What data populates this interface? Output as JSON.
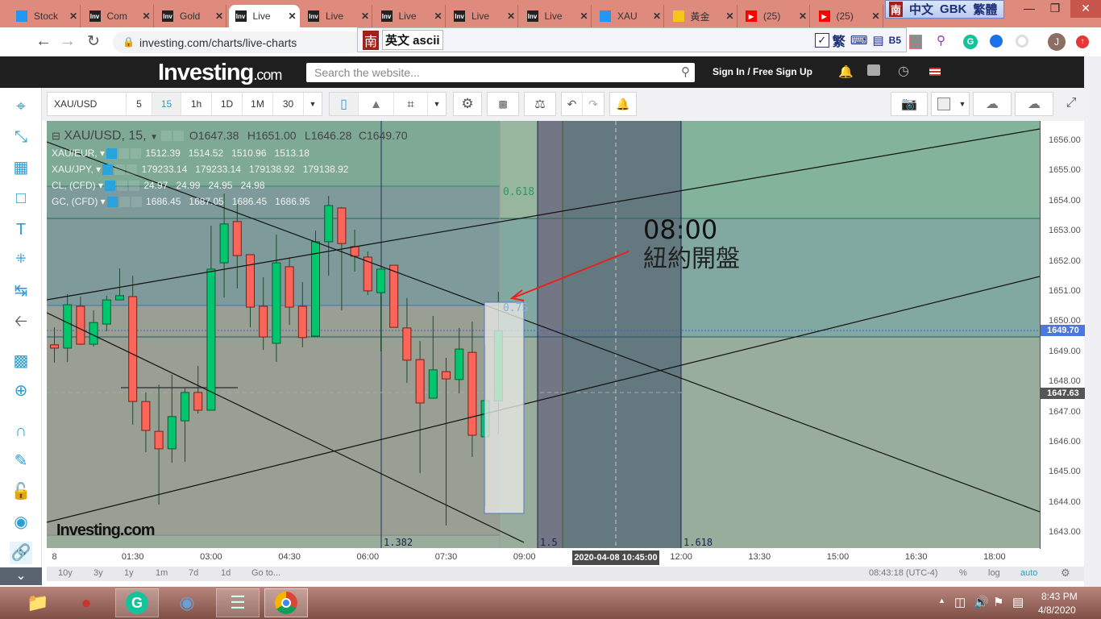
{
  "browser": {
    "tabs": [
      {
        "title": "Stock",
        "icon": "cloud"
      },
      {
        "title": "Com",
        "icon": "inv"
      },
      {
        "title": "Gold",
        "icon": "inv"
      },
      {
        "title": "Live",
        "icon": "inv"
      },
      {
        "title": "Live",
        "icon": "inv"
      },
      {
        "title": "Live",
        "icon": "inv"
      },
      {
        "title": "Live",
        "icon": "inv"
      },
      {
        "title": "Live",
        "icon": "inv"
      },
      {
        "title": "XAU",
        "icon": "cloud"
      },
      {
        "title": "黃金",
        "icon": "gem"
      },
      {
        "title": "(25)",
        "icon": "youtube"
      },
      {
        "title": "(25)",
        "icon": "youtube"
      }
    ],
    "active_tab": 3,
    "url": "investing.com/charts/live-charts",
    "ime_top": {
      "icon": "南",
      "mode": "中文",
      "enc": "GBK",
      "script": "繁體"
    },
    "ime_bar": {
      "icon": "南",
      "mode": "英文 ascii",
      "icons": [
        "繁",
        "B5"
      ]
    },
    "avatar": "J"
  },
  "site": {
    "logo": "Investing",
    "logo_suffix": ".com",
    "search_placeholder": "Search the website...",
    "signin": "Sign In / Free Sign Up"
  },
  "toolbar": {
    "symbol": "XAU/USD",
    "intervals": [
      "5",
      "15",
      "1h",
      "1D",
      "1M",
      "30"
    ],
    "active_interval": "15"
  },
  "legend": {
    "main": {
      "symbol": "XAU/USD, 15,",
      "o": "O1647.38",
      "h": "H1651.00",
      "l": "L1646.28",
      "c": "C1649.70"
    },
    "overlays": [
      {
        "name": "XAU/EUR,",
        "values": "1512.39   1514.52   1510.96   1513.18"
      },
      {
        "name": "XAU/JPY,",
        "values": "179233.14   179233.14   179138.92   179138.92"
      },
      {
        "name": "CL, (CFD)",
        "values": "24.97   24.99   24.95   24.98"
      },
      {
        "name": "GC, (CFD)",
        "values": "1686.45   1687.05   1686.45   1686.95"
      }
    ]
  },
  "annotations": {
    "time": "08:00",
    "text": "紐約開盤",
    "fib_labels": [
      "0.618",
      "0.75",
      "1.382",
      "1.5",
      "1.618"
    ],
    "watermark": "Investing.com"
  },
  "chart_data": {
    "type": "candlestick",
    "symbol": "XAU/USD",
    "interval": "15",
    "ylim": [
      1642.6,
      1656.7
    ],
    "yticks": [
      1643,
      1644,
      1645,
      1646,
      1647,
      1648,
      1649,
      1650,
      1651,
      1652,
      1653,
      1654,
      1655,
      1656
    ],
    "xtick_labels": [
      {
        "t": 0,
        "label": "8"
      },
      {
        "t": 6,
        "label": "01:30"
      },
      {
        "t": 12,
        "label": "03:00"
      },
      {
        "t": 18,
        "label": "04:30"
      },
      {
        "t": 24,
        "label": "06:00"
      },
      {
        "t": 30,
        "label": "07:30"
      },
      {
        "t": 36,
        "label": "09:00"
      },
      {
        "t": 48,
        "label": "12:00"
      },
      {
        "t": 54,
        "label": "13:30"
      },
      {
        "t": 60,
        "label": "15:00"
      },
      {
        "t": 66,
        "label": "16:30"
      },
      {
        "t": 72,
        "label": "18:00"
      }
    ],
    "crosshair_time": "2020-04-08 10:45:00",
    "last_price": "1649.70",
    "crosshair_price": "1647.63",
    "candles": [
      [
        1649.24,
        1649.82,
        1648.65,
        1649.13
      ],
      [
        1649.13,
        1650.92,
        1648.67,
        1650.57
      ],
      [
        1650.52,
        1650.84,
        1649.24,
        1649.26
      ],
      [
        1649.26,
        1650.38,
        1649.18,
        1649.98
      ],
      [
        1649.93,
        1650.87,
        1649.69,
        1650.73
      ],
      [
        1650.73,
        1651.78,
        1650.73,
        1650.87
      ],
      [
        1650.84,
        1651.53,
        1646.59,
        1647.36
      ],
      [
        1647.36,
        1647.66,
        1645.68,
        1646.4
      ],
      [
        1646.37,
        1647.92,
        1643.94,
        1645.79
      ],
      [
        1645.79,
        1648.25,
        1645.33,
        1646.86
      ],
      [
        1646.72,
        1647.79,
        1645.36,
        1647.66
      ],
      [
        1647.66,
        1648.54,
        1646.96,
        1647.07
      ],
      [
        1647.07,
        1653.19,
        1647.07,
        1651.75
      ],
      [
        1651.96,
        1654.26,
        1650.81,
        1653.25
      ],
      [
        1653.33,
        1653.91,
        1651.11,
        1652.2
      ],
      [
        1652.23,
        1652.23,
        1649.82,
        1650.49
      ],
      [
        1650.52,
        1651.48,
        1649.07,
        1649.5
      ],
      [
        1649.29,
        1652.9,
        1648.67,
        1651.96
      ],
      [
        1651.83,
        1652.12,
        1649.9,
        1650.49
      ],
      [
        1650.52,
        1651.32,
        1649.16,
        1649.48
      ],
      [
        1649.53,
        1653.03,
        1649.53,
        1652.66
      ],
      [
        1652.66,
        1654.18,
        1651.53,
        1653.86
      ],
      [
        1653.78,
        1653.81,
        1650.38,
        1652.6
      ],
      [
        1652.5,
        1653.06,
        1651.67,
        1652.18
      ],
      [
        1652.15,
        1652.34,
        1650.89,
        1651.03
      ],
      [
        1650.97,
        1651.75,
        1649.02,
        1651.75
      ],
      [
        1651.88,
        1651.88,
        1649.82,
        1649.82
      ],
      [
        1649.8,
        1650.79,
        1647.98,
        1648.73
      ],
      [
        1648.75,
        1649.37,
        1644.98,
        1647.31
      ],
      [
        1647.47,
        1650.2,
        1647.47,
        1648.41
      ],
      [
        1648.35,
        1648.81,
        1643.25,
        1648.11
      ],
      [
        1648.09,
        1649.8,
        1647.63,
        1649.1
      ],
      [
        1648.99,
        1650.01,
        1645.52,
        1646.24
      ],
      [
        1646.19,
        1649.24,
        1643.89,
        1647.39
      ],
      [
        1647.38,
        1651.0,
        1646.28,
        1649.7
      ]
    ],
    "colors": {
      "up": "#00c66e",
      "down": "#fc6559"
    }
  },
  "bottom": {
    "ranges": [
      "10y",
      "3y",
      "1y",
      "1m",
      "7d",
      "1d",
      "Go to..."
    ],
    "clock": "08:43:18 (UTC-4)",
    "pct": "%",
    "log": "log",
    "auto": "auto"
  },
  "taskbar": {
    "time": "8:43 PM",
    "date": "4/8/2020"
  }
}
